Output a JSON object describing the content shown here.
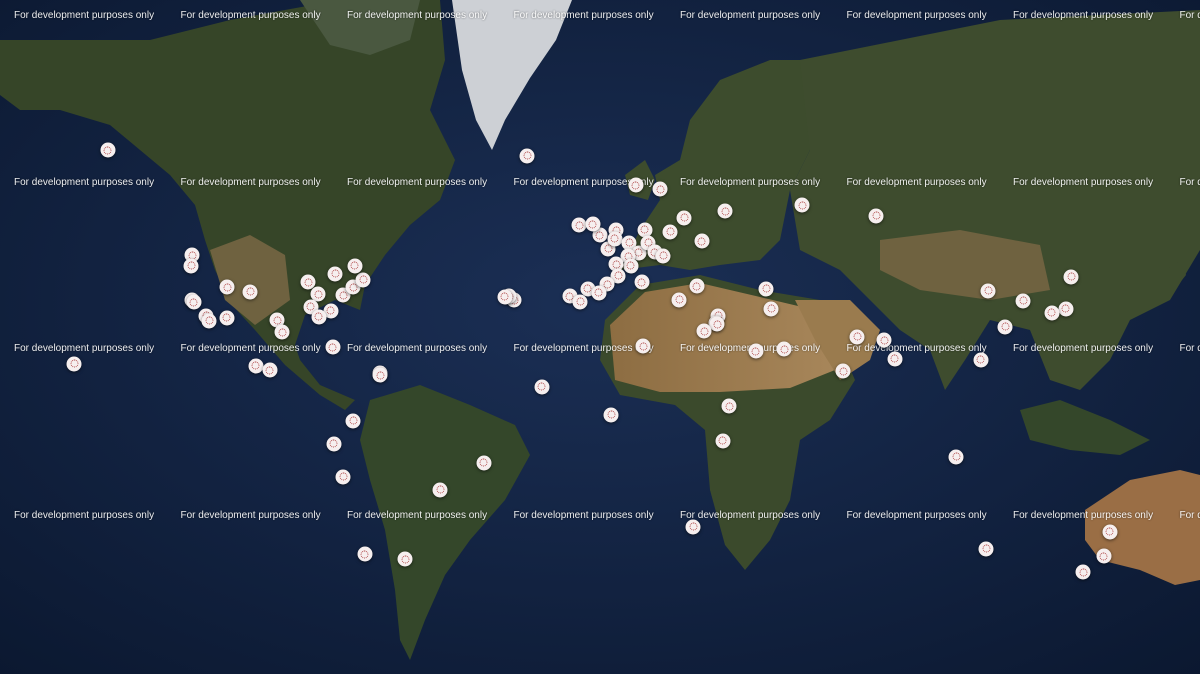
{
  "map": {
    "style": "satellite",
    "watermark_text": "For development purposes only",
    "colors": {
      "ocean": "#13264a",
      "land": "#3b4a2c",
      "desert": "#9a7b4e",
      "ice": "#d6d8dc",
      "marker": "#f6efef",
      "marker_accent": "#b04a4a"
    }
  },
  "markers": [
    {
      "lat": 64.8,
      "lng": -147.7
    },
    {
      "lat": 47.6,
      "lng": -122.3
    },
    {
      "lat": 45.5,
      "lng": -122.7
    },
    {
      "lat": 37.8,
      "lng": -122.4
    },
    {
      "lat": 37.3,
      "lng": -121.9
    },
    {
      "lat": 34.0,
      "lng": -118.2
    },
    {
      "lat": 32.7,
      "lng": -117.2
    },
    {
      "lat": 39.7,
      "lng": -105.0
    },
    {
      "lat": 40.8,
      "lng": -111.9
    },
    {
      "lat": 33.4,
      "lng": -112.0
    },
    {
      "lat": 41.9,
      "lng": -87.6
    },
    {
      "lat": 39.1,
      "lng": -84.5
    },
    {
      "lat": 35.2,
      "lng": -80.8
    },
    {
      "lat": 36.2,
      "lng": -86.8
    },
    {
      "lat": 33.7,
      "lng": -84.4
    },
    {
      "lat": 32.8,
      "lng": -96.8
    },
    {
      "lat": 29.8,
      "lng": -95.4
    },
    {
      "lat": 38.9,
      "lng": -77.0
    },
    {
      "lat": 40.7,
      "lng": -74.0
    },
    {
      "lat": 42.4,
      "lng": -71.1
    },
    {
      "lat": 43.7,
      "lng": -79.4
    },
    {
      "lat": 45.5,
      "lng": -73.6
    },
    {
      "lat": 25.8,
      "lng": -80.2
    },
    {
      "lat": 20.7,
      "lng": -103.3
    },
    {
      "lat": 19.4,
      "lng": -99.1
    },
    {
      "lat": 21.3,
      "lng": -157.8
    },
    {
      "lat": 18.5,
      "lng": -66.1
    },
    {
      "lat": 18.0,
      "lng": -66.0
    },
    {
      "lat": 4.7,
      "lng": -74.1
    },
    {
      "lat": -2.2,
      "lng": -79.9
    },
    {
      "lat": -12.0,
      "lng": -77.0
    },
    {
      "lat": -15.8,
      "lng": -47.9
    },
    {
      "lat": -8.0,
      "lng": -34.9
    },
    {
      "lat": -33.4,
      "lng": -70.6
    },
    {
      "lat": -34.6,
      "lng": -58.4
    },
    {
      "lat": 37.7,
      "lng": -25.7
    },
    {
      "lat": 38.7,
      "lng": -27.2
    },
    {
      "lat": 38.5,
      "lng": -28.6
    },
    {
      "lat": 64.1,
      "lng": -21.9
    },
    {
      "lat": 59.9,
      "lng": 10.7
    },
    {
      "lat": 59.3,
      "lng": 18.1
    },
    {
      "lat": 55.8,
      "lng": 37.6
    },
    {
      "lat": 56.8,
      "lng": 60.6
    },
    {
      "lat": 55.0,
      "lng": 82.9
    },
    {
      "lat": 53.3,
      "lng": -6.3
    },
    {
      "lat": 51.5,
      "lng": -0.1
    },
    {
      "lat": 53.5,
      "lng": -2.2
    },
    {
      "lat": 48.9,
      "lng": 2.4
    },
    {
      "lat": 52.4,
      "lng": 4.9
    },
    {
      "lat": 50.9,
      "lng": 4.4
    },
    {
      "lat": 52.5,
      "lng": 13.4
    },
    {
      "lat": 50.1,
      "lng": 8.7
    },
    {
      "lat": 48.1,
      "lng": 11.6
    },
    {
      "lat": 47.4,
      "lng": 8.5
    },
    {
      "lat": 45.5,
      "lng": 9.2
    },
    {
      "lat": 45.8,
      "lng": 4.8
    },
    {
      "lat": 43.3,
      "lng": 5.4
    },
    {
      "lat": 41.9,
      "lng": 12.5
    },
    {
      "lat": 41.4,
      "lng": 2.2
    },
    {
      "lat": 40.4,
      "lng": -3.7
    },
    {
      "lat": 38.7,
      "lng": -9.1
    },
    {
      "lat": 39.5,
      "lng": -0.4
    },
    {
      "lat": 37.4,
      "lng": -6.0
    },
    {
      "lat": 50.1,
      "lng": 14.4
    },
    {
      "lat": 48.2,
      "lng": 16.4
    },
    {
      "lat": 52.2,
      "lng": 21.0
    },
    {
      "lat": 47.5,
      "lng": 19.0
    },
    {
      "lat": 50.4,
      "lng": 30.5
    },
    {
      "lat": 54.7,
      "lng": 25.3
    },
    {
      "lat": 37.9,
      "lng": 23.7
    },
    {
      "lat": 41.0,
      "lng": 29.0
    },
    {
      "lat": 33.9,
      "lng": 35.5
    },
    {
      "lat": 32.1,
      "lng": 34.8
    },
    {
      "lat": 31.8,
      "lng": 35.2
    },
    {
      "lat": 30.0,
      "lng": 31.2
    },
    {
      "lat": 35.7,
      "lng": 51.4
    },
    {
      "lat": 25.2,
      "lng": 55.3
    },
    {
      "lat": 24.7,
      "lng": 46.7
    },
    {
      "lat": 40.4,
      "lng": 49.9
    },
    {
      "lat": 26.0,
      "lng": 13.0
    },
    {
      "lat": 6.5,
      "lng": 3.4
    },
    {
      "lat": 9.0,
      "lng": 38.7
    },
    {
      "lat": -1.3,
      "lng": 36.8
    },
    {
      "lat": -26.2,
      "lng": 28.0
    },
    {
      "lat": 14.7,
      "lng": -17.5
    },
    {
      "lat": 28.6,
      "lng": 77.2
    },
    {
      "lat": 19.1,
      "lng": 72.9
    },
    {
      "lat": 22.6,
      "lng": 88.4
    },
    {
      "lat": 27.7,
      "lng": 85.3
    },
    {
      "lat": 39.9,
      "lng": 116.4
    },
    {
      "lat": 31.2,
      "lng": 121.5
    },
    {
      "lat": 22.3,
      "lng": 114.2
    },
    {
      "lat": -6.2,
      "lng": 106.8
    },
    {
      "lat": 37.6,
      "lng": 127.0
    },
    {
      "lat": 35.7,
      "lng": 139.7
    },
    {
      "lat": 34.7,
      "lng": 135.5
    },
    {
      "lat": 43.1,
      "lng": 141.4
    },
    {
      "lat": -31.9,
      "lng": 115.9
    },
    {
      "lat": -33.9,
      "lng": 151.2
    },
    {
      "lat": -37.8,
      "lng": 145.0
    },
    {
      "lat": -27.5,
      "lng": 153.0
    }
  ]
}
